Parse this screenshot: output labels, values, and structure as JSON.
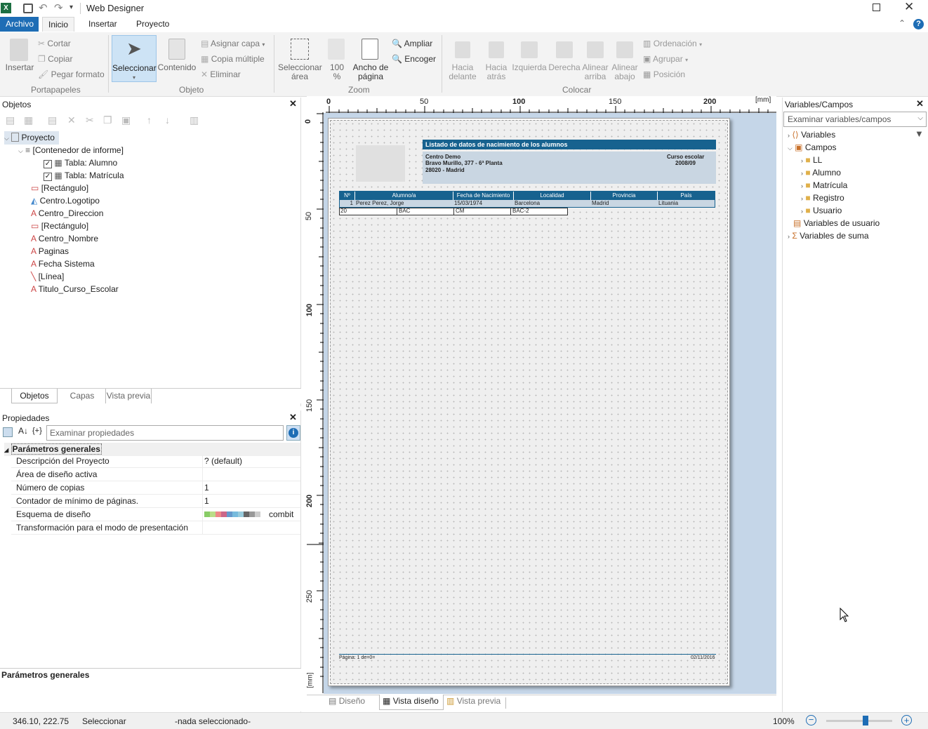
{
  "window": {
    "title": "Web Designer"
  },
  "tabs": [
    {
      "label": "Archivo"
    },
    {
      "label": "Inicio"
    },
    {
      "label": "Insertar"
    },
    {
      "label": "Proyecto"
    }
  ],
  "ribbon": {
    "insertar": "Insertar",
    "cortar": "Cortar",
    "copiar": "Copiar",
    "pegar_formato": "Pegar formato",
    "grp_portapapeles": "Portapapeles",
    "seleccionar": "Seleccionar",
    "contenido": "Contenido",
    "asignar_capa": "Asignar capa",
    "copia_multiple": "Copia múltiple",
    "eliminar": "Eliminar",
    "grp_objeto": "Objeto",
    "seleccionar_area_1": "Seleccionar",
    "seleccionar_area_2": "área",
    "zoom100_1": "100",
    "zoom100_2": "%",
    "ancho_1": "Ancho de",
    "ancho_2": "página",
    "ampliar": "Ampliar",
    "encoger": "Encoger",
    "grp_zoom": "Zoom",
    "hacia_delante_1": "Hacia",
    "hacia_delante_2": "delante",
    "hacia_atras_1": "Hacia",
    "hacia_atras_2": "atrás",
    "izquierda": "Izquierda",
    "derecha": "Derecha",
    "alinear_arriba_1": "Alinear",
    "alinear_arriba_2": "arriba",
    "alinear_abajo_1": "Alinear",
    "alinear_abajo_2": "abajo",
    "ordenacion": "Ordenación",
    "agrupar": "Agrupar",
    "posicion": "Posición",
    "grp_colocar": "Colocar"
  },
  "objetos": {
    "title": "Objetos",
    "items": [
      {
        "label": "Proyecto"
      },
      {
        "label": "[Contenedor de informe]"
      },
      {
        "label": "Tabla: Alumno"
      },
      {
        "label": "Tabla: Matrícula"
      },
      {
        "label": "[Rectángulo]"
      },
      {
        "label": "Centro.Logotipo"
      },
      {
        "label": "Centro_Direccion"
      },
      {
        "label": "[Rectángulo]"
      },
      {
        "label": "Centro_Nombre"
      },
      {
        "label": "Paginas"
      },
      {
        "label": "Fecha Sistema"
      },
      {
        "label": "[Línea]"
      },
      {
        "label": "Titulo_Curso_Escolar"
      }
    ],
    "bottom_tabs": [
      {
        "label": "Objetos"
      },
      {
        "label": "Capas"
      },
      {
        "label": "Vista previa"
      }
    ]
  },
  "propiedades": {
    "title": "Propiedades",
    "search_placeholder": "Examinar propiedades",
    "section": "Parámetros generales",
    "rows": [
      {
        "name": "Descripción del Proyecto",
        "value": "? (default)"
      },
      {
        "name": "Área de diseño activa",
        "value": ""
      },
      {
        "name": "Número de copias",
        "value": "1"
      },
      {
        "name": "Contador de mínimo de páginas.",
        "value": "1"
      },
      {
        "name": "Esquema de diseño",
        "value": "combit"
      },
      {
        "name": "Transformación para el modo de presentación",
        "value": ""
      }
    ],
    "footer": "Parámetros generales"
  },
  "ruler": {
    "h": [
      "0",
      "50",
      "100",
      "150",
      "200",
      "[mm]"
    ],
    "v": [
      "0",
      "50",
      "100",
      "150",
      "200",
      "250",
      "[mm]"
    ]
  },
  "report": {
    "title": "Listado de datos de nacimiento de los alumnos",
    "center_name": "Centro Demo",
    "address_1": "Bravo Murillo, 377 - 6ª Planta",
    "address_2": "28020 - Madrid",
    "course_label": "Curso escolar",
    "course_value": "2008/09",
    "headers": [
      "Nº",
      "Alumno/a",
      "Fecha de Nacimiento",
      "Localidad",
      "Provincia",
      "País"
    ],
    "row": [
      "1",
      "Perez Perez, Jorge",
      "15/03/1974",
      "Barcelona",
      "Madrid",
      "Lituania"
    ],
    "subrow": [
      "20",
      "BAC",
      "CM",
      "BAC-2"
    ],
    "footer_left": "Página: 1 de=0=",
    "footer_right": "02/11/2016"
  },
  "designer_tabs": [
    {
      "label": "Diseño"
    },
    {
      "label": "Vista diseño"
    },
    {
      "label": "Vista previa"
    }
  ],
  "variables": {
    "title": "Variables/Campos",
    "search_placeholder": "Examinar variables/campos",
    "items": [
      {
        "label": "Variables"
      },
      {
        "label": "Campos"
      },
      {
        "label": "LL"
      },
      {
        "label": "Alumno"
      },
      {
        "label": "Matrícula"
      },
      {
        "label": "Registro"
      },
      {
        "label": "Usuario"
      },
      {
        "label": "Variables de usuario"
      },
      {
        "label": "Variables de suma"
      }
    ]
  },
  "status": {
    "coords": "346.10, 222.75",
    "mode": "Seleccionar",
    "selection": "-nada seleccionado-",
    "zoom": "100%",
    "zoom_level": 0.6
  },
  "colors": {
    "accent": "#1e6db5",
    "report_header": "#17628f",
    "report_band": "#c9d6e2"
  }
}
